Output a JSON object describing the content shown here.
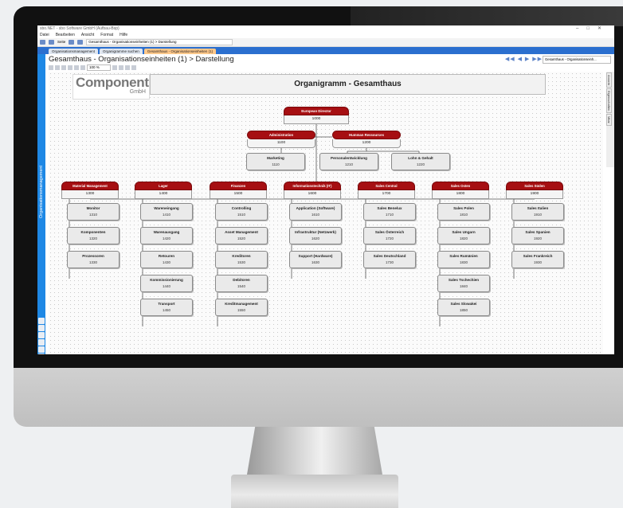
{
  "window": {
    "title": "sbo.NET - sbo Software GmbH (Aufbau-Bsp)"
  },
  "menu": [
    "Datei",
    "Bearbeiten",
    "Ansicht",
    "Format",
    "Hilfe"
  ],
  "toolbar": {
    "page_label": "Seite",
    "address": "Gesamthaus - Organisationseinheiten (1) > Darstellung"
  },
  "tabs": [
    {
      "label": "Organisationsmanagement"
    },
    {
      "label": "Organigramme suchen"
    },
    {
      "label": "Gesamthaus - Organisationseinheiten (1)"
    }
  ],
  "sidebar": {
    "label": "Organisationsmanagement"
  },
  "page": {
    "title": "Gesamthaus - Organisationseinheiten (1) > Darstellung",
    "zoom": "100 %",
    "nav_select": "Gesamthaus - Organisationseinh..."
  },
  "right_tabs": [
    "Ansicht",
    "Eigenschaften",
    "Mitar"
  ],
  "header": {
    "logo_main": "Component",
    "logo_sub": "GmbH",
    "title": "Organigramm - Gesamthaus"
  },
  "org": {
    "root": {
      "name": "European Director",
      "code": "1000"
    },
    "level1": [
      {
        "name": "Administration",
        "code": "1100"
      },
      {
        "name": "Humman Ressources",
        "code": "1200"
      }
    ],
    "level1_children": [
      {
        "name": "Marketing",
        "code": "1110"
      },
      {
        "name": "Personalentwicklung",
        "code": "1210"
      },
      {
        "name": "Lohn & Gehalt",
        "code": "1220"
      }
    ],
    "departments": [
      {
        "name": "Material Management",
        "code": "1300",
        "children": [
          {
            "name": "Monitor",
            "code": "1310"
          },
          {
            "name": "Komponenten",
            "code": "1320"
          },
          {
            "name": "Prozessoren",
            "code": "1330"
          }
        ]
      },
      {
        "name": "Lager",
        "code": "1400",
        "children": [
          {
            "name": "Wareneingang",
            "code": "1410"
          },
          {
            "name": "Warenausgang",
            "code": "1420"
          },
          {
            "name": "Retouren",
            "code": "1430"
          },
          {
            "name": "Kommissionierung",
            "code": "1440"
          },
          {
            "name": "Transport",
            "code": "1450"
          }
        ]
      },
      {
        "name": "Finanzen",
        "code": "1500",
        "children": [
          {
            "name": "Controlling",
            "code": "1510"
          },
          {
            "name": "Asset Management",
            "code": "1520"
          },
          {
            "name": "Kreditoren",
            "code": "1530"
          },
          {
            "name": "Debitoren",
            "code": "1540"
          },
          {
            "name": "Kreditmanagement",
            "code": "1550"
          }
        ]
      },
      {
        "name": "Informationstechnik (IT)",
        "code": "1600",
        "children": [
          {
            "name": "Application (Software)",
            "code": "1610"
          },
          {
            "name": "Infrastruktur (Netzwerk)",
            "code": "1620"
          },
          {
            "name": "Support (Hardware)",
            "code": "1630"
          }
        ]
      },
      {
        "name": "Sales Central",
        "code": "1700",
        "children": [
          {
            "name": "Sales Benelux",
            "code": "1710"
          },
          {
            "name": "Sales Österreich",
            "code": "1720"
          },
          {
            "name": "Sales Deutschland",
            "code": "1730"
          }
        ]
      },
      {
        "name": "Sales Osten",
        "code": "1800",
        "children": [
          {
            "name": "Sales Polen",
            "code": "1810"
          },
          {
            "name": "Sales Ungarn",
            "code": "1820"
          },
          {
            "name": "Sales Rumänien",
            "code": "1830"
          },
          {
            "name": "Sales Tschechien",
            "code": "1840"
          },
          {
            "name": "Sales Slowakei",
            "code": "1850"
          }
        ]
      },
      {
        "name": "Sales Süden",
        "code": "1900",
        "children": [
          {
            "name": "Sales Italien",
            "code": "1910"
          },
          {
            "name": "Sales Spanien",
            "code": "1920"
          },
          {
            "name": "Sales Frankreich",
            "code": "1930"
          }
        ]
      }
    ]
  },
  "colors": {
    "accent": "#1e88e5",
    "node_header": "#a60f12",
    "active_tab": "#ffc88a"
  }
}
